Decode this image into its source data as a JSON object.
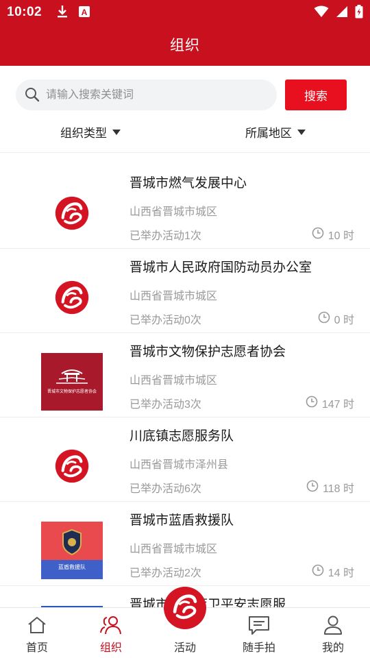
{
  "status_bar": {
    "time": "10:02"
  },
  "header": {
    "title": "组织"
  },
  "search": {
    "placeholder": "请输入搜索关键词",
    "button_label": "搜索"
  },
  "filters": [
    {
      "label": "组织类型"
    },
    {
      "label": "所属地区"
    }
  ],
  "organizations": [
    {
      "name": "晋城市燃气发展中心",
      "region": "山西省晋城市城区",
      "activities": "已举办活动1次",
      "hours": "10 时",
      "logo": "volunteer-emblem"
    },
    {
      "name": "晋城市人民政府国防动员办公室",
      "region": "山西省晋城市城区",
      "activities": "已举办活动0次",
      "hours": "0 时",
      "logo": "volunteer-emblem"
    },
    {
      "name": "晋城市文物保护志愿者协会",
      "region": "山西省晋城市城区",
      "activities": "已举办活动3次",
      "hours": "147 时",
      "logo": "cultural-relics-association-logo"
    },
    {
      "name": "川底镇志愿服务队",
      "region": "山西省晋城市泽州县",
      "activities": "已举办活动6次",
      "hours": "118 时",
      "logo": "volunteer-emblem"
    },
    {
      "name": "晋城市蓝盾救援队",
      "region": "山西省晋城市城区",
      "activities": "已举办活动2次",
      "hours": "14 时",
      "logo": "blue-shield-rescue-logo"
    },
    {
      "name": "晋城市凤城蓝卫平安志愿服",
      "region": "",
      "activities": "",
      "hours": "",
      "logo": "blue-logo-partial"
    }
  ],
  "logo_texts": {
    "cultural_relics": "晋城市文物保护志愿者协会",
    "blue_shield": "蓝盾救援队"
  },
  "bottom_nav": [
    {
      "label": "首页",
      "icon": "home-icon",
      "active": false
    },
    {
      "label": "组织",
      "icon": "organization-icon",
      "active": true
    },
    {
      "label": "活动",
      "icon": "volunteer-emblem",
      "active": false
    },
    {
      "label": "随手拍",
      "icon": "message-icon",
      "active": false
    },
    {
      "label": "我的",
      "icon": "profile-icon",
      "active": false
    }
  ],
  "colors": {
    "brand_red": "#c8101e",
    "button_red": "#e8101e",
    "muted_text": "#999999",
    "relics_logo_bg": "#a8192b",
    "blue_shield_top": "#e84a4e",
    "blue_shield_bottom": "#3f5fc9"
  }
}
